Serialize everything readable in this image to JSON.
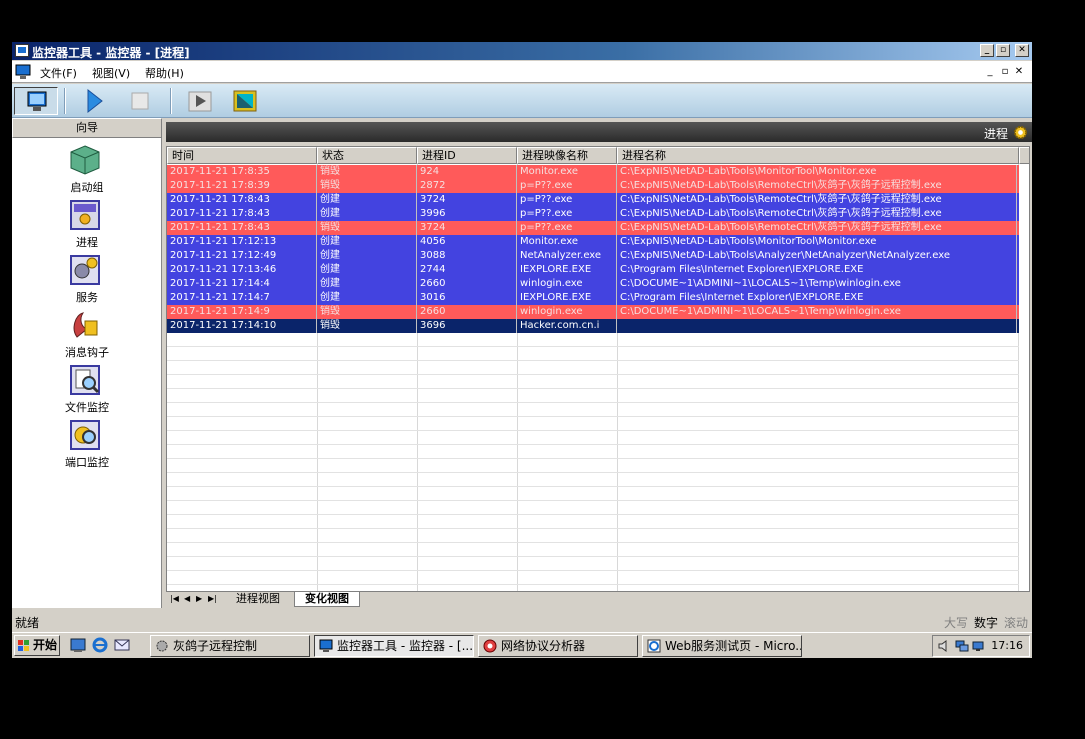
{
  "window": {
    "title": "监控器工具 - 监控器 - [进程]",
    "caption_buttons": [
      "_",
      "▫",
      "✕"
    ],
    "mdi_buttons": [
      "_",
      "▫",
      "✕"
    ]
  },
  "menu": [
    "文件(F)",
    "视图(V)",
    "帮助(H)"
  ],
  "toolbar": {
    "buttons": [
      "monitor-icon",
      "play-icon",
      "stop-icon",
      "step-icon",
      "window-icon"
    ]
  },
  "nav": {
    "header": "向导",
    "items": [
      {
        "label": "启动组",
        "icon": "startup-group-icon"
      },
      {
        "label": "进程",
        "icon": "process-icon"
      },
      {
        "label": "服务",
        "icon": "service-icon"
      },
      {
        "label": "消息钩子",
        "icon": "message-hook-icon"
      },
      {
        "label": "文件监控",
        "icon": "file-monitor-icon"
      },
      {
        "label": "端口监控",
        "icon": "port-monitor-icon"
      }
    ]
  },
  "panel": {
    "title": "进程",
    "icon": "gear-icon"
  },
  "table": {
    "columns": [
      "时间",
      "状态",
      "进程ID",
      "进程映像名称",
      "进程名称"
    ],
    "rows": [
      {
        "time": "2017-11-21 17:8:35",
        "status": "销毁",
        "pid": "924",
        "image": "Monitor.exe",
        "path": "C:\\ExpNIS\\NetAD-Lab\\Tools\\MonitorTool\\Monitor.exe",
        "style": "red"
      },
      {
        "time": "2017-11-21 17:8:39",
        "status": "销毁",
        "pid": "2872",
        "image": "p=P??.exe",
        "path": "C:\\ExpNIS\\NetAD-Lab\\Tools\\RemoteCtrl\\灰鸽子\\灰鸽子远程控制.exe",
        "style": "red"
      },
      {
        "time": "2017-11-21 17:8:43",
        "status": "创建",
        "pid": "3724",
        "image": "p=P??.exe",
        "path": "C:\\ExpNIS\\NetAD-Lab\\Tools\\RemoteCtrl\\灰鸽子\\灰鸽子远程控制.exe",
        "style": "blue"
      },
      {
        "time": "2017-11-21 17:8:43",
        "status": "创建",
        "pid": "3996",
        "image": "p=P??.exe",
        "path": "C:\\ExpNIS\\NetAD-Lab\\Tools\\RemoteCtrl\\灰鸽子\\灰鸽子远程控制.exe",
        "style": "blue"
      },
      {
        "time": "2017-11-21 17:8:43",
        "status": "销毁",
        "pid": "3724",
        "image": "p=P??.exe",
        "path": "C:\\ExpNIS\\NetAD-Lab\\Tools\\RemoteCtrl\\灰鸽子\\灰鸽子远程控制.exe",
        "style": "red"
      },
      {
        "time": "2017-11-21 17:12:13",
        "status": "创建",
        "pid": "4056",
        "image": "Monitor.exe",
        "path": "C:\\ExpNIS\\NetAD-Lab\\Tools\\MonitorTool\\Monitor.exe",
        "style": "blue"
      },
      {
        "time": "2017-11-21 17:12:49",
        "status": "创建",
        "pid": "3088",
        "image": "NetAnalyzer.exe",
        "path": "C:\\ExpNIS\\NetAD-Lab\\Tools\\Analyzer\\NetAnalyzer\\NetAnalyzer.exe",
        "style": "blue"
      },
      {
        "time": "2017-11-21 17:13:46",
        "status": "创建",
        "pid": "2744",
        "image": "IEXPLORE.EXE",
        "path": "C:\\Program Files\\Internet Explorer\\IEXPLORE.EXE",
        "style": "blue"
      },
      {
        "time": "2017-11-21 17:14:4",
        "status": "创建",
        "pid": "2660",
        "image": "winlogin.exe",
        "path": "C:\\DOCUME~1\\ADMINI~1\\LOCALS~1\\Temp\\winlogin.exe",
        "style": "blue"
      },
      {
        "time": "2017-11-21 17:14:7",
        "status": "创建",
        "pid": "3016",
        "image": "IEXPLORE.EXE",
        "path": "C:\\Program Files\\Internet Explorer\\IEXPLORE.EXE",
        "style": "blue"
      },
      {
        "time": "2017-11-21 17:14:9",
        "status": "销毁",
        "pid": "2660",
        "image": "winlogin.exe",
        "path": "C:\\DOCUME~1\\ADMINI~1\\LOCALS~1\\Temp\\winlogin.exe",
        "style": "red"
      },
      {
        "time": "2017-11-21 17:14:10",
        "status": "销毁",
        "pid": "3696",
        "image": "Hacker.com.cn.i",
        "path": "",
        "style": "sel"
      }
    ]
  },
  "tabs": [
    "进程视图",
    "变化视图"
  ],
  "active_tab": "变化视图",
  "status": {
    "left": "就绪",
    "caps": "大写",
    "num": "数字",
    "scroll": "滚动"
  },
  "taskbar": {
    "start": "开始",
    "quicklaunch": [
      "desktop-icon",
      "ie-icon",
      "outlook-icon"
    ],
    "tasks": [
      {
        "label": "灰鸽子远程控制",
        "icon": "gear-icon",
        "active": false
      },
      {
        "label": "监控器工具 - 监控器 - [...",
        "icon": "monitor-icon",
        "active": true
      },
      {
        "label": "网络协议分析器",
        "icon": "analyzer-icon",
        "active": false
      },
      {
        "label": "Web服务测试页 - Micro...",
        "icon": "ie-icon",
        "active": false
      }
    ],
    "tray_icons": [
      "volume-icon",
      "network-icon",
      "network2-icon"
    ],
    "clock": "17:16"
  },
  "colors": {
    "destroy_row": "#ff5a5a",
    "create_row": "#4343e0",
    "selected_row": "#0a246a"
  }
}
